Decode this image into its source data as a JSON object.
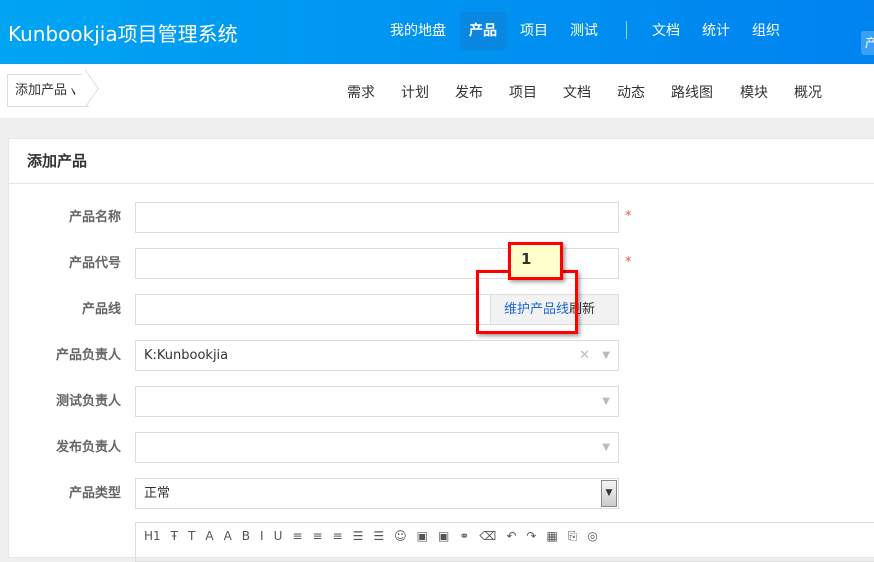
{
  "header": {
    "brand": "Kunbookjia项目管理系统",
    "nav": [
      "我的地盘",
      "产品",
      "项目",
      "测试"
    ],
    "nav2": [
      "文档",
      "统计",
      "组织"
    ],
    "active": "产品",
    "side_tab": "产"
  },
  "subnav": {
    "dropdown": "添加产品",
    "items": [
      "需求",
      "计划",
      "发布",
      "项目",
      "文档",
      "动态",
      "路线图",
      "模块",
      "概况"
    ]
  },
  "form": {
    "title": "添加产品",
    "labels": {
      "name": "产品名称",
      "code": "产品代号",
      "line": "产品线",
      "po": "产品负责人",
      "qd": "测试负责人",
      "rd": "发布负责人",
      "type": "产品类型"
    },
    "po_value": "K:Kunbookjia",
    "type_value": "正常",
    "maintain_line": "维护产品线",
    "refresh": "刷新",
    "required": "*"
  },
  "toolbar": [
    "H1",
    "Ŧ",
    "T",
    "A",
    "A",
    "B",
    "I",
    "U",
    "≡",
    "≡",
    "≡",
    "☰",
    "☰",
    "☺",
    "▣",
    "▣",
    "⚭",
    "⌫",
    "↶",
    "↷",
    "▦",
    "⎘",
    "◎"
  ],
  "annotation": {
    "label": "1",
    "color": "#ff0000"
  }
}
